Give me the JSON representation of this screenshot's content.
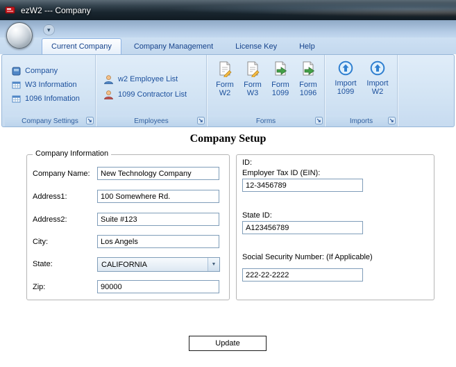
{
  "window": {
    "title": "ezW2 --- Company"
  },
  "icons": {
    "qat_dropdown": "▾",
    "combo_arrow": "▼"
  },
  "colors": {
    "accent_blue": "#15428b",
    "ribbon_bg": "#d3e4f4",
    "title_bar": "#1a2730",
    "app_icon_red": "#c8171d"
  },
  "ribbon": {
    "tabs": [
      {
        "label": "Current Company",
        "active": true
      },
      {
        "label": "Company Management",
        "active": false
      },
      {
        "label": "License Key",
        "active": false
      },
      {
        "label": "Help",
        "active": false
      }
    ],
    "groups": [
      {
        "label": "Company Settings",
        "items": [
          {
            "label": "Company",
            "icon": "company-icon"
          },
          {
            "label": "W3 Information",
            "icon": "table-icon"
          },
          {
            "label": "1096 Infomation",
            "icon": "table-icon"
          }
        ]
      },
      {
        "label": "Employees",
        "items": [
          {
            "label": "w2 Employee List",
            "icon": "person-icon"
          },
          {
            "label": "1099 Contractor List",
            "icon": "person-icon"
          }
        ]
      },
      {
        "label": "Forms",
        "items": [
          {
            "label": "Form\nW2",
            "icon": "form-edit-icon"
          },
          {
            "label": "Form\nW3",
            "icon": "form-edit-icon"
          },
          {
            "label": "Form\n1099",
            "icon": "form-export-icon"
          },
          {
            "label": "Form\n1096",
            "icon": "form-export-icon"
          }
        ]
      },
      {
        "label": "Imports",
        "items": [
          {
            "label": "Import\n1099",
            "icon": "import-circle-icon"
          },
          {
            "label": "Import\nW2",
            "icon": "import-circle-icon"
          }
        ]
      }
    ]
  },
  "main": {
    "title": "Company Setup",
    "company_info": {
      "legend": "Company Information",
      "company_name": {
        "label": "Company Name:",
        "value": "New Technology Company"
      },
      "address1": {
        "label": "Address1:",
        "value": "100 Somewhere Rd."
      },
      "address2": {
        "label": "Address2:",
        "value": "Suite #123"
      },
      "city": {
        "label": "City:",
        "value": "Los Angels"
      },
      "state": {
        "label": "State:",
        "value": "CALIFORNIA"
      },
      "zip": {
        "label": "Zip:",
        "value": "90000"
      }
    },
    "ids": {
      "heading": "ID:",
      "ein": {
        "label": "Employer Tax ID (EIN):",
        "value": "12-3456789"
      },
      "state_id": {
        "label": "State ID:",
        "value": "A123456789"
      },
      "ssn": {
        "label": "Social Security Number: (If Applicable)",
        "value": "222-22-2222"
      }
    },
    "update_button": "Update"
  }
}
